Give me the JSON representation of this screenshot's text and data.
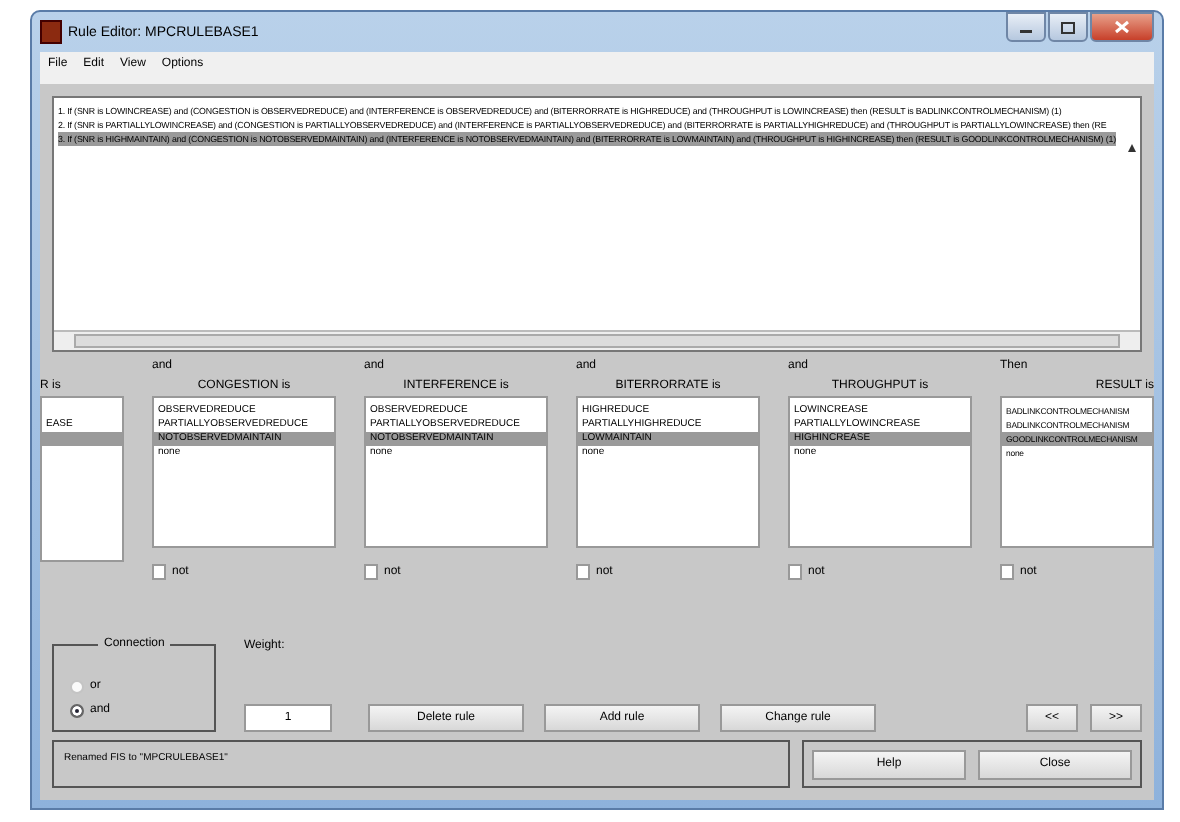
{
  "window": {
    "title": "Rule Editor: MPCRULEBASE1"
  },
  "menu": [
    "File",
    "Edit",
    "View",
    "Options"
  ],
  "rules": [
    {
      "text": "1. If (SNR is LOWINCREASE) and (CONGESTION is OBSERVEDREDUCE) and (INTERFERENCE is OBSERVEDREDUCE) and (BITERRORRATE is HIGHREDUCE) and (THROUGHPUT is LOWINCREASE) then (RESULT is BADLINKCONTROLMECHANISM) (1)",
      "selected": false
    },
    {
      "text": "2. If (SNR is PARTIALLYLOWINCREASE) and (CONGESTION is PARTIALLYOBSERVEDREDUCE) and (INTERFERENCE is PARTIALLYOBSERVEDREDUCE) and (BITERRORRATE is PARTIALLYHIGHREDUCE) and (THROUGHPUT is PARTIALLYLOWINCREASE) then (RE",
      "selected": false
    },
    {
      "text": "3. If (SNR is HIGHMAINTAIN) and (CONGESTION is NOTOBSERVEDMAINTAIN) and (INTERFERENCE is NOTOBSERVEDMAINTAIN) and (BITERRORRATE is LOWMAINTAIN) and (THROUGHPUT is HIGHINCREASE) then (RESULT is GOODLINKCONTROLMECHANISM) (1)",
      "selected": true
    }
  ],
  "columns": [
    {
      "label": "R is",
      "options": [
        {
          "text": "EASE",
          "selected": false
        },
        {
          "selected": true
        }
      ]
    },
    {
      "connector": "and",
      "label": "CONGESTION is",
      "options": [
        {
          "text": "OBSERVEDREDUCE",
          "selected": false
        },
        {
          "text": "PARTIALLYOBSERVEDREDUCE",
          "selected": false
        },
        {
          "text": "NOTOBSERVEDMAINTAIN",
          "selected": true
        },
        {
          "text": "none",
          "selected": false
        }
      ],
      "not": {
        "label": "not",
        "checked": false
      }
    },
    {
      "connector": "and",
      "label": "INTERFERENCE is",
      "options": [
        {
          "text": "OBSERVEDREDUCE",
          "selected": false
        },
        {
          "text": "PARTIALLYOBSERVEDREDUCE",
          "selected": false
        },
        {
          "text": "NOTOBSERVEDMAINTAIN",
          "selected": true
        },
        {
          "text": "none",
          "selected": false
        }
      ],
      "not": {
        "label": "not",
        "checked": false
      }
    },
    {
      "connector": "and",
      "label": "BITERRORRATE is",
      "options": [
        {
          "text": "HIGHREDUCE",
          "selected": false
        },
        {
          "text": "PARTIALLYHIGHREDUCE",
          "selected": false
        },
        {
          "text": "LOWMAINTAIN",
          "selected": true
        },
        {
          "text": "none",
          "selected": false
        }
      ],
      "not": {
        "label": "not",
        "checked": false
      }
    },
    {
      "connector": "and",
      "label": "THROUGHPUT is",
      "options": [
        {
          "text": "LOWINCREASE",
          "selected": false
        },
        {
          "text": "PARTIALLYLOWINCREASE",
          "selected": false
        },
        {
          "text": "HIGHINCREASE",
          "selected": true
        },
        {
          "text": "none",
          "selected": false
        }
      ],
      "not": {
        "label": "not",
        "checked": false
      }
    },
    {
      "connector": "Then",
      "label": "RESULT is",
      "options": [
        {
          "text": "BADLINKCONTROLMECHANISM",
          "selected": false
        },
        {
          "text": "BADLINKCONTROLMECHANISM",
          "selected": false
        },
        {
          "text": "GOODLINKCONTROLMECHANISM",
          "selected": true
        },
        {
          "text": "none",
          "selected": false
        }
      ],
      "not": {
        "label": "not",
        "checked": false
      }
    }
  ],
  "connection": {
    "title": "Connection",
    "options": [
      {
        "label": "or",
        "selected": false
      },
      {
        "label": "and",
        "selected": true
      }
    ]
  },
  "weight": {
    "label": "Weight:",
    "value": "1"
  },
  "buttons": [
    "Delete rule",
    "Add rule",
    "Change rule"
  ],
  "nav_buttons": [
    "<<",
    ">>"
  ],
  "status": "Renamed FIS to \"MPCRULEBASE1\"",
  "footer_buttons": [
    "Help",
    "Close"
  ]
}
